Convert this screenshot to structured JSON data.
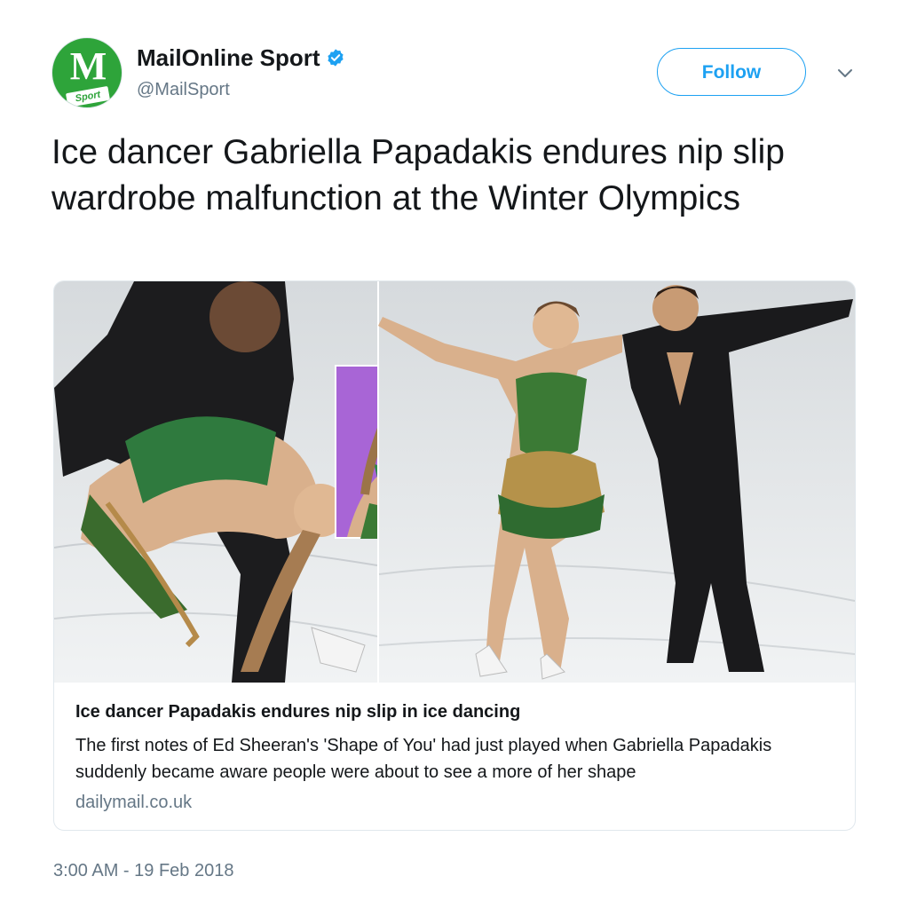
{
  "account": {
    "display_name": "MailOnline Sport",
    "handle": "@MailSport",
    "avatar_monogram": "M",
    "avatar_tag": "Sport",
    "verified": true,
    "brand_color": "#2ea43a"
  },
  "follow_button": {
    "label": "Follow",
    "color": "#1da1f2"
  },
  "tweet": {
    "text": "Ice dancer Gabriella Papadakis endures nip slip wardrobe malfunction at the Winter Olympics",
    "timestamp": "3:00 AM - 19 Feb 2018"
  },
  "card": {
    "title": "Ice dancer Papadakis endures nip slip in ice dancing",
    "description": "The first notes of Ed Sheeran's 'Shape of You' had just played when Gabriella Papadakis suddenly became aware people were about to see a more of her shape",
    "domain": "dailymail.co.uk"
  },
  "icons": {
    "verified": "verified-badge-icon",
    "caret": "chevron-down-icon"
  }
}
